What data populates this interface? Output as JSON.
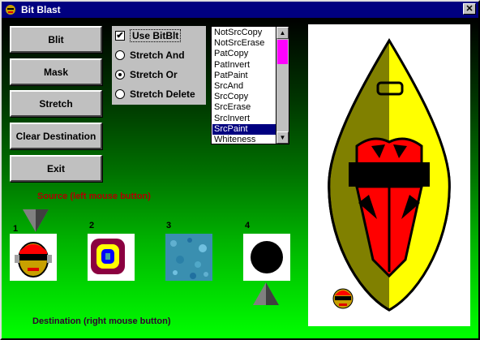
{
  "window": {
    "title": "Bit Blast",
    "close_glyph": "✕"
  },
  "buttons": {
    "blit": "Blit",
    "mask": "Mask",
    "stretch": "Stretch",
    "clear": "Clear Destination",
    "exit": "Exit"
  },
  "options": {
    "use_bitblt": {
      "label": "Use BitBlt",
      "checked": true
    },
    "radios": [
      {
        "label": "Stretch And",
        "selected": false
      },
      {
        "label": "Stretch Or",
        "selected": true
      },
      {
        "label": "Stretch Delete",
        "selected": false
      }
    ]
  },
  "rop_list": {
    "items": [
      "NotSrcCopy",
      "NotSrcErase",
      "PatCopy",
      "PatInvert",
      "PatPaint",
      "SrcAnd",
      "SrcCopy",
      "SrcErase",
      "SrcInvert",
      "SrcPaint",
      "Whiteness"
    ],
    "selected": "SrcPaint"
  },
  "labels": {
    "source": "Source (left mouse button)",
    "destination": "Destination (right mouse button)"
  },
  "tiles": [
    {
      "number": "1",
      "icon": "face-icon"
    },
    {
      "number": "2",
      "icon": "target-rings-icon"
    },
    {
      "number": "3",
      "icon": "noise-texture-icon"
    },
    {
      "number": "4",
      "icon": "black-circle-icon"
    }
  ],
  "colors": {
    "title_bar": "#000080",
    "source_label": "#b00000",
    "destination_label": "#300030",
    "list_selected": "#000080",
    "scroll_thumb": "#ff00ff"
  }
}
